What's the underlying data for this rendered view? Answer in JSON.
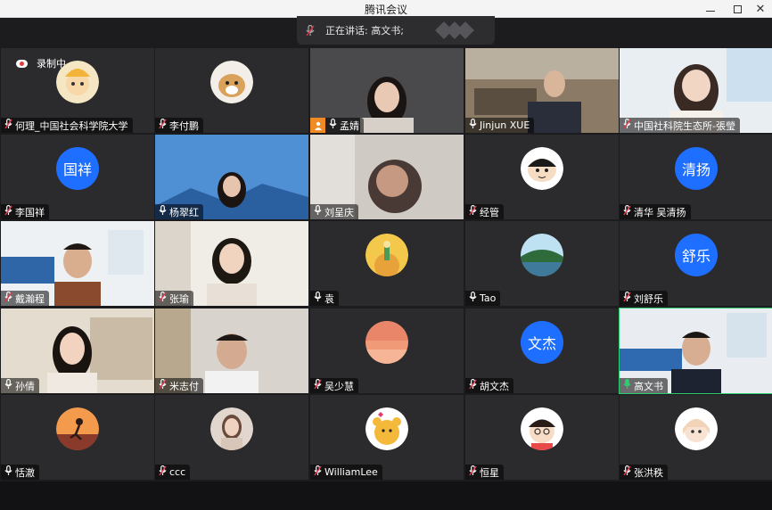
{
  "window": {
    "title": "腾讯会议"
  },
  "speaking": {
    "text": "正在讲话: 高文书;"
  },
  "recording": {
    "label": "录制中"
  },
  "participants": [
    {
      "name": "何理_中国社会科学院大学",
      "mic": "muted",
      "avatar": "cartoon-boy-icon",
      "kind": "icon"
    },
    {
      "name": "李付鹏",
      "mic": "muted",
      "avatar": "dog-icon",
      "kind": "icon"
    },
    {
      "name": "孟婧",
      "mic": "on",
      "host": true,
      "kind": "video"
    },
    {
      "name": "Jinjun XUE",
      "mic": "on",
      "kind": "video"
    },
    {
      "name": "中国社科院生态所-張瑩",
      "mic": "muted",
      "kind": "video"
    },
    {
      "name": "李国祥",
      "mic": "muted",
      "avatar_text": "国祥",
      "kind": "text"
    },
    {
      "name": "杨翠红",
      "mic": "on",
      "kind": "video"
    },
    {
      "name": "刘呈庆",
      "mic": "on",
      "kind": "video"
    },
    {
      "name": "经管",
      "mic": "muted",
      "avatar": "cartoon-kid-icon",
      "kind": "icon"
    },
    {
      "name": "清华 吴清扬",
      "mic": "muted",
      "avatar_text": "清扬",
      "kind": "text"
    },
    {
      "name": "戴瀚程",
      "mic": "muted",
      "kind": "video"
    },
    {
      "name": "张瑜",
      "mic": "muted",
      "kind": "video"
    },
    {
      "name": "袁",
      "mic": "on",
      "avatar": "little-prince-icon",
      "kind": "icon"
    },
    {
      "name": "Tao",
      "mic": "on",
      "avatar": "lake-icon",
      "kind": "icon"
    },
    {
      "name": "刘舒乐",
      "mic": "muted",
      "avatar_text": "舒乐",
      "kind": "text"
    },
    {
      "name": "孙倩",
      "mic": "on",
      "kind": "video"
    },
    {
      "name": "米志付",
      "mic": "muted",
      "kind": "video"
    },
    {
      "name": "吴少慧",
      "mic": "muted",
      "avatar": "sunset-icon",
      "kind": "icon"
    },
    {
      "name": "胡文杰",
      "mic": "muted",
      "avatar_text": "文杰",
      "kind": "text"
    },
    {
      "name": "高文书",
      "mic": "speaking",
      "kind": "video"
    },
    {
      "name": "恬澈",
      "mic": "on",
      "avatar": "running-girl-icon",
      "kind": "icon"
    },
    {
      "name": "ccc",
      "mic": "muted",
      "avatar": "woman-portrait-icon",
      "kind": "icon"
    },
    {
      "name": "WilliamLee",
      "mic": "muted",
      "avatar": "winnie-pooh-icon",
      "kind": "icon"
    },
    {
      "name": "恒星",
      "mic": "muted",
      "avatar": "cartoon-boy-glasses-icon",
      "kind": "icon"
    },
    {
      "name": "张洪秩",
      "mic": "muted",
      "avatar": "cartoon-girl-icon",
      "kind": "icon"
    }
  ],
  "colors": {
    "speaking": "#2ecc71",
    "muted": "#e0344b",
    "avatar_blue": "#1e6fff",
    "host": "#f08a24"
  }
}
